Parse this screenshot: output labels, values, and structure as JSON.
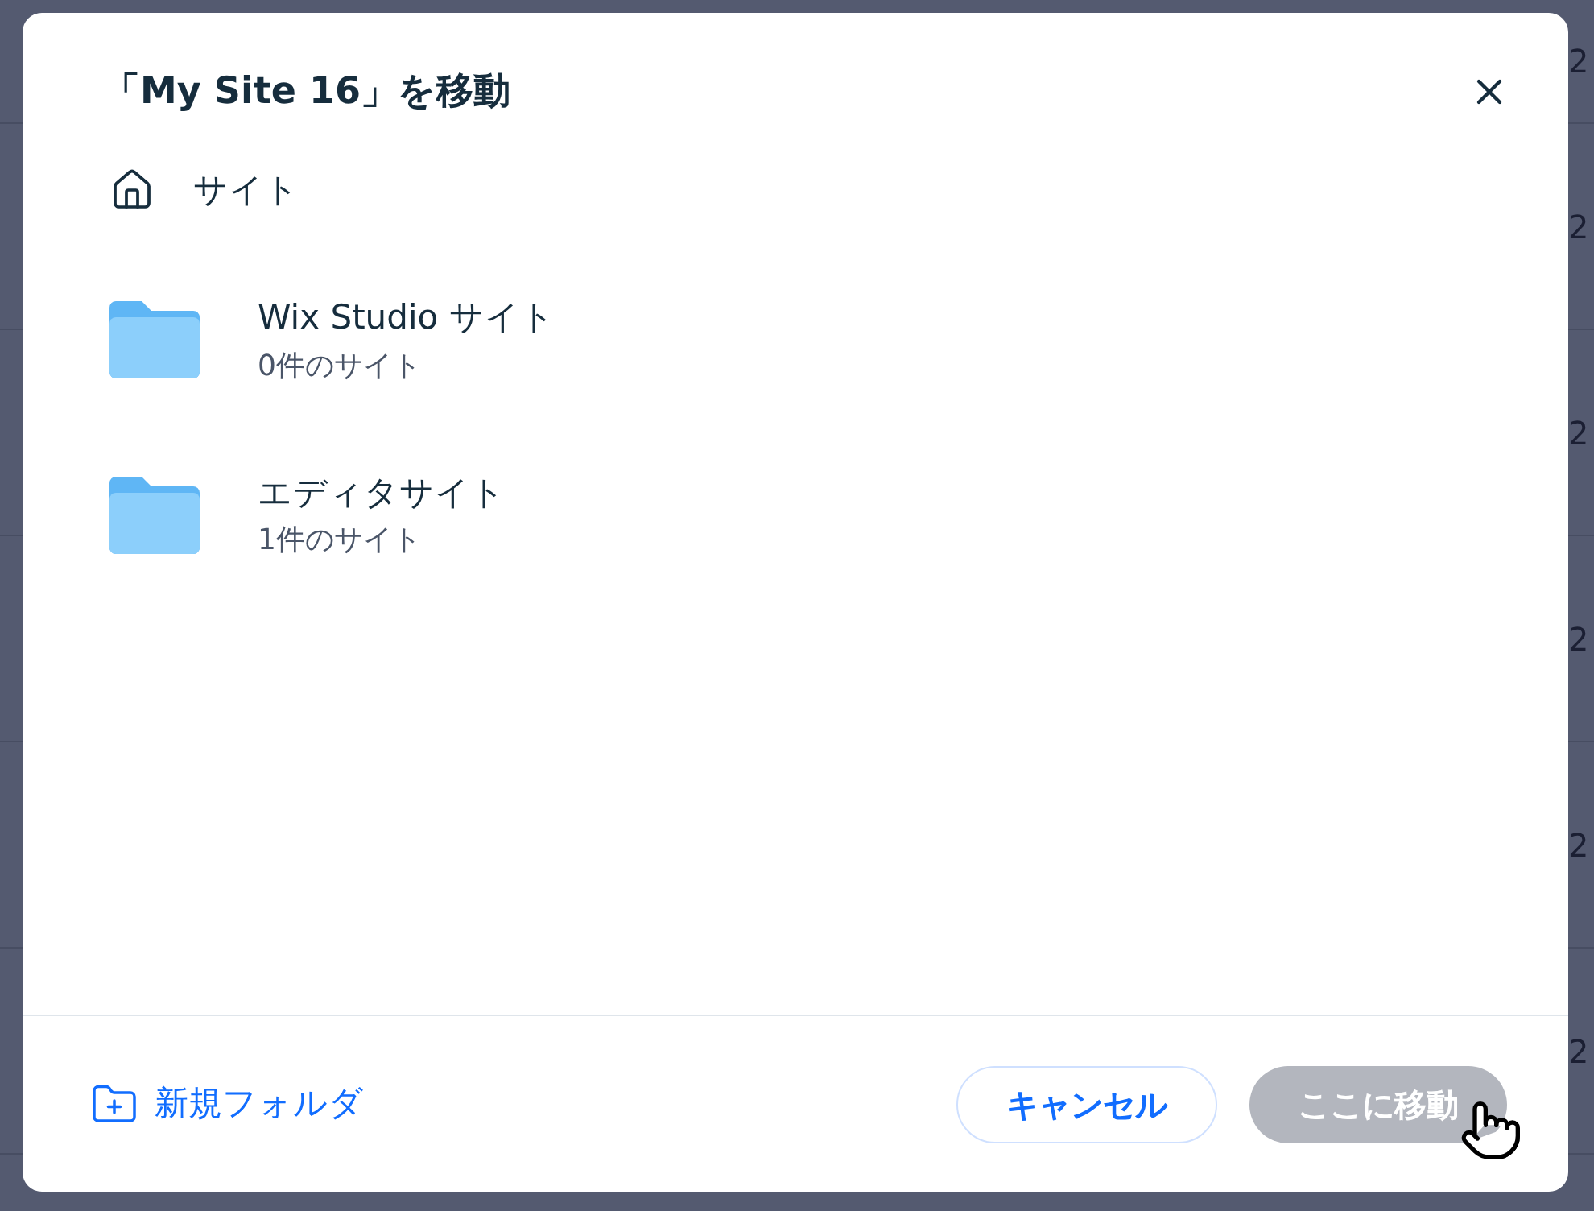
{
  "background_rows": [
    {
      "column_1": "2"
    },
    {
      "column_1": "2"
    },
    {
      "column_1": "2"
    },
    {
      "column_1": "2"
    },
    {
      "column_1": "2"
    },
    {
      "column_1": "2"
    }
  ],
  "dialog": {
    "title": "「My Site 16」を移動",
    "breadcrumb": {
      "label": "サイト"
    },
    "folders": [
      {
        "name": "Wix Studio サイト",
        "count": "0件のサイト"
      },
      {
        "name": "エディタサイト",
        "count": "1件のサイト"
      }
    ],
    "new_folder": "新規フォルダ",
    "buttons": [
      {
        "label": "キャンセル",
        "kind": "secondary",
        "disabled": false
      },
      {
        "label": "ここに移動",
        "kind": "primary",
        "disabled": true
      }
    ]
  }
}
